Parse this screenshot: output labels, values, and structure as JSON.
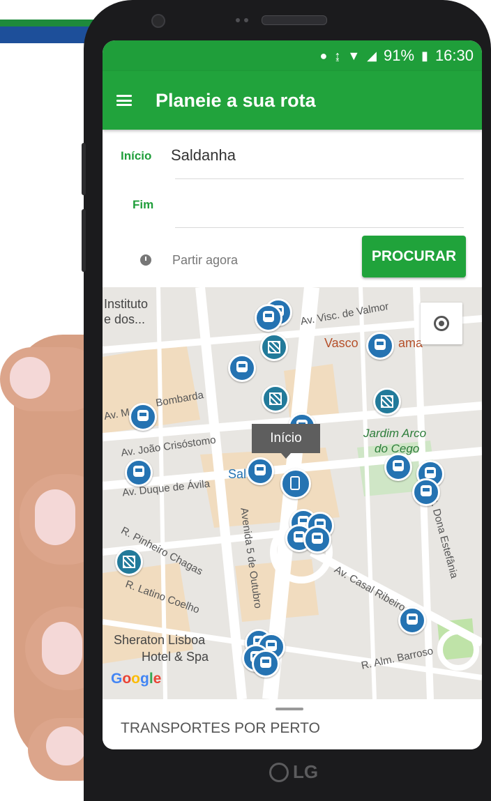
{
  "status_bar": {
    "battery": "91%",
    "time": "16:30",
    "icons": [
      "location-icon",
      "vibrate-icon",
      "wifi-icon",
      "signal-icon",
      "battery-icon"
    ]
  },
  "app_bar": {
    "title": "Planeie a sua rota",
    "menu_icon": "hamburger-menu-icon"
  },
  "form": {
    "start_label": "Início",
    "start_value": "Saldanha",
    "end_label": "Fim",
    "end_value": "",
    "depart_label": "Partir agora",
    "search_button": "PROCURAR"
  },
  "map": {
    "labels": {
      "instituto_1": "Instituto",
      "instituto_2": "e dos...",
      "visc_valmor": "Av. Visc. de Valmor",
      "vasco": "Vasco",
      "vasco_suffix": "ama",
      "bombarda": "Bombarda",
      "av_m": "Av. M",
      "joao_crisostomo": "Av. João Crisóstomo",
      "jardim_1": "Jardim Arco",
      "jardim_2": "do Cego",
      "duque_avila": "Av. Duque de Ávila",
      "sal": "Sal",
      "pinheiro_chagas": "R. Pinheiro Chagas",
      "latino_coelho": "R. Latino Coelho",
      "cinco_outubro": "Avenida 5 de Outubro",
      "casal_ribeiro": "Av. Casal Ribeiro",
      "dona_estefania": "R. Dona Estefânia",
      "sheraton_1": "Sheraton Lisboa",
      "sheraton_2": "Hotel & Spa",
      "alm_barroso": "R. Alm. Barroso"
    },
    "tooltip": "Início",
    "google": "Google",
    "google_colors": [
      "#4285f4",
      "#ea4335",
      "#fbbc05",
      "#4285f4",
      "#34a853",
      "#ea4335"
    ]
  },
  "bottom_sheet": {
    "title": "TRANSPORTES POR PERTO"
  },
  "device": {
    "brand": "LG"
  },
  "colors": {
    "primary": "#21a33c",
    "status": "#1f9e3a",
    "pin": "#2573b2",
    "brand_blue": "#1d4f9a",
    "brand_green": "#1e8a3c"
  }
}
